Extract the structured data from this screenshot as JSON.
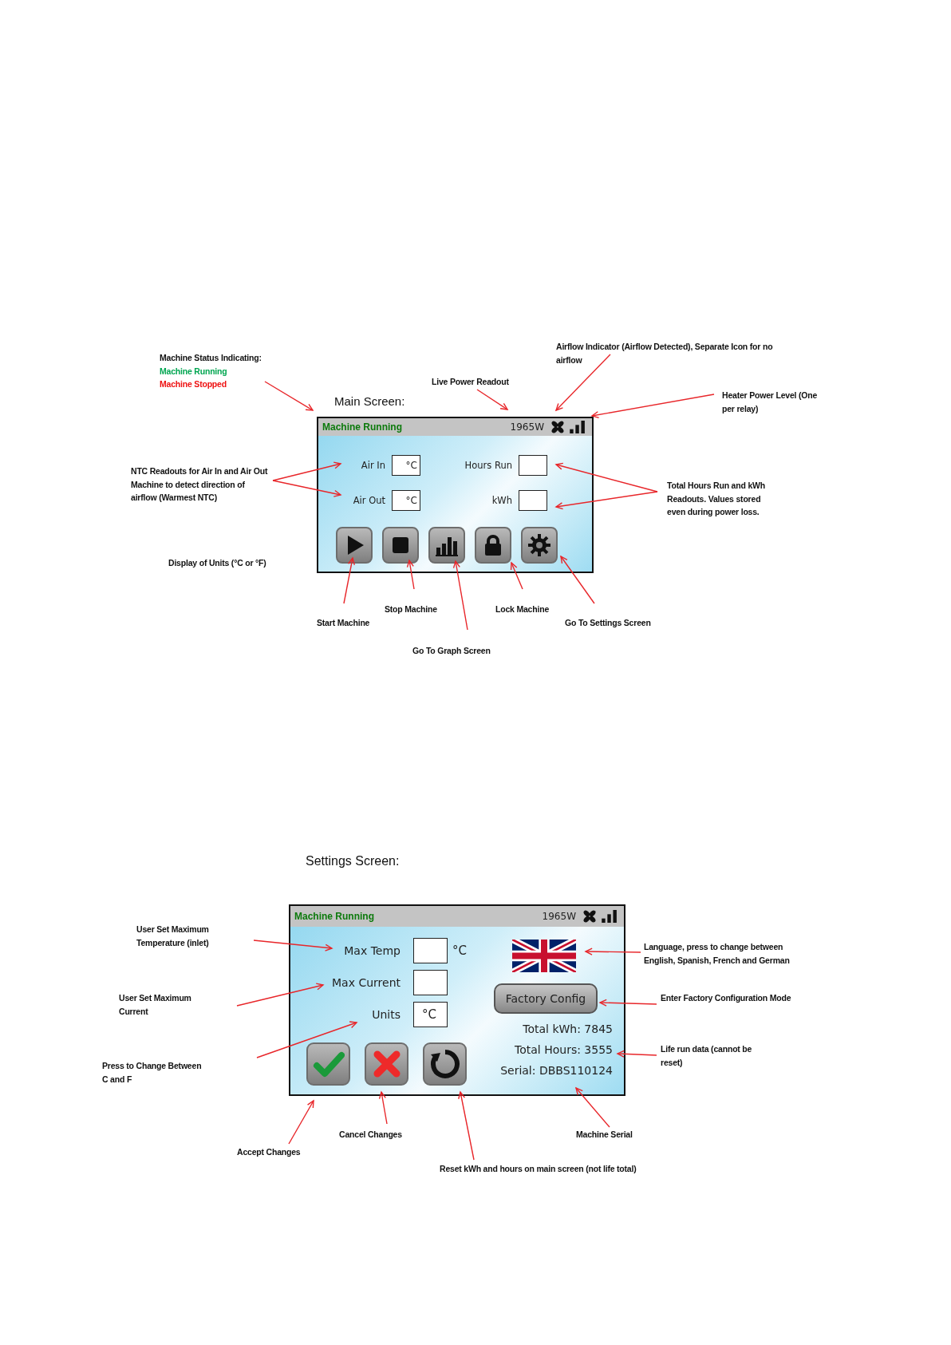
{
  "main_section": {
    "title": "Main Screen:",
    "status_legend": {
      "title": "Machine Status Indicating:",
      "items": [
        {
          "text": "Machine Running",
          "color": "#00a651"
        },
        {
          "text": "Machine Stopped",
          "color": "#ee1111"
        }
      ]
    },
    "screen": {
      "status": {
        "label": "Machine Running",
        "running": true
      },
      "power": "1965W",
      "readings": [
        {
          "label": "Air In",
          "value": "°C",
          "total_label": "Hours Run"
        },
        {
          "label": "Air Out",
          "value": "°C",
          "total_label": "kWh"
        }
      ],
      "buttons": [
        {
          "kind": "play"
        },
        {
          "kind": "stop"
        },
        {
          "kind": "graph"
        },
        {
          "kind": "lock"
        },
        {
          "kind": "settings"
        }
      ]
    },
    "annotations": [
      {
        "lines": [
          "Live Power Readout"
        ]
      },
      {
        "lines": [
          "Airflow Indicator (Airflow Detected), Separate Icon for no",
          "airflow"
        ]
      },
      {
        "lines": [
          "Heater Power Level (One",
          "per relay)"
        ]
      },
      {
        "lines": [
          "NTC Readouts for Air In and Air Out",
          "Machine to detect direction of",
          "airflow (Warmest NTC)"
        ]
      },
      {
        "lines": [
          "Total Hours Run and kWh",
          "Readouts. Values stored",
          "even during power loss."
        ]
      },
      {
        "lines": [
          "Display of Units (°C or °F)"
        ]
      },
      {
        "lines": [
          "Stop Machine"
        ]
      },
      {
        "lines": [
          "Lock Machine"
        ]
      },
      {
        "lines": [
          "Start Machine"
        ]
      },
      {
        "lines": [
          "Go To Settings Screen"
        ]
      },
      {
        "lines": [
          "Go To Graph Screen"
        ]
      }
    ]
  },
  "settings_section": {
    "title": "Settings Screen:",
    "screen": {
      "status": {
        "label": "Machine Running",
        "running": true
      },
      "power": "1965W",
      "fields": [
        {
          "label": "Max Temp",
          "suffix": "°C"
        },
        {
          "label": "Max Current"
        },
        {
          "label": "Units",
          "value": "°C"
        }
      ],
      "buttons": [
        {
          "kind": "accept"
        },
        {
          "kind": "cancel"
        },
        {
          "kind": "reset"
        }
      ],
      "factory_button": "Factory Config",
      "life_data": [
        "Total kWh: 7845",
        "Total Hours: 3555",
        "Serial: DBBS110124"
      ]
    },
    "annotations": [
      {
        "lines": [
          "User Set Maximum",
          "Temperature (inlet)"
        ]
      },
      {
        "lines": [
          "Language, press to change between",
          "English, Spanish, French and German"
        ]
      },
      {
        "lines": [
          "User Set Maximum",
          "Current"
        ]
      },
      {
        "lines": [
          "Enter Factory Configuration Mode"
        ]
      },
      {
        "lines": [
          "Press to Change Between",
          "C and F"
        ]
      },
      {
        "lines": [
          "Life run data (cannot be",
          "reset)"
        ]
      },
      {
        "lines": [
          "Cancel Changes"
        ]
      },
      {
        "lines": [
          "Machine Serial"
        ]
      },
      {
        "lines": [
          "Accept Changes"
        ]
      },
      {
        "lines": [
          "Reset kWh and hours on main screen (not life total)"
        ]
      }
    ]
  }
}
